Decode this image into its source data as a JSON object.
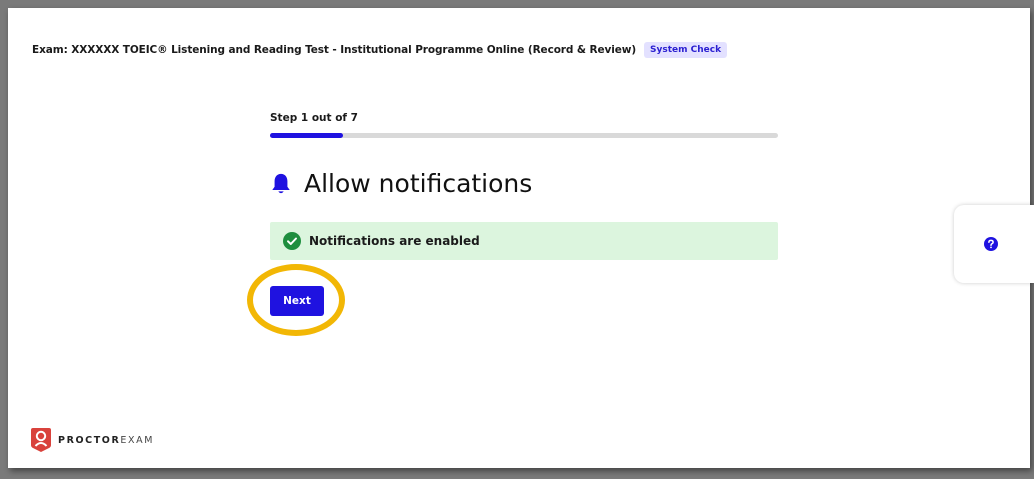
{
  "header": {
    "exam_title": "Exam: XXXXXX TOEIC® Listening and Reading Test - Institutional Programme Online (Record & Review)",
    "badge": "System Check"
  },
  "wizard": {
    "step_label": "Step 1 out of 7",
    "progress_fraction": 0.143,
    "heading": "Allow notifications",
    "status_message": "Notifications are enabled",
    "next_label": "Next"
  },
  "help": {
    "icon": "question-circle-icon"
  },
  "brand": {
    "name_bold": "PROCTOR",
    "name_light": "EXAM"
  },
  "colors": {
    "accent": "#1f12e0",
    "success_bg": "#dcf5de",
    "success_icon": "#1e8e3e",
    "highlight": "#f2b705",
    "brand_red": "#d9423c"
  }
}
